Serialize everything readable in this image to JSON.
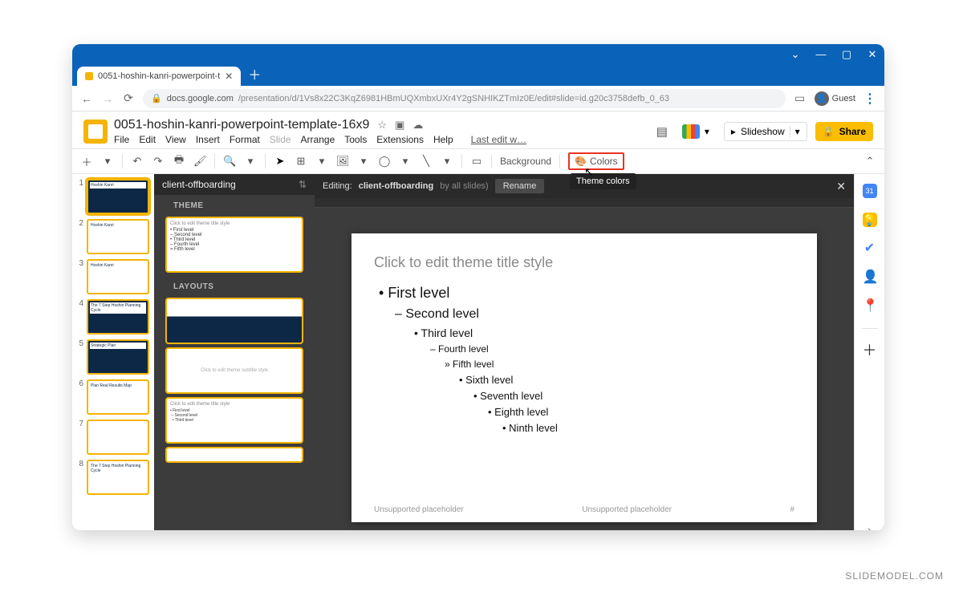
{
  "browser": {
    "tab_title": "0051-hoshin-kanri-powerpoint-t",
    "url_host": "docs.google.com",
    "url_path": "/presentation/d/1Vs8x22C3KqZ6981HBmUQXmbxUXr4Y2gSNHIKZTmIz0E/edit#slide=id.g20c3758defb_0_63",
    "guest_label": "Guest"
  },
  "header": {
    "doc_title": "0051-hoshin-kanri-powerpoint-template-16x9",
    "menus": [
      "File",
      "Edit",
      "View",
      "Insert",
      "Format",
      "Slide",
      "Arrange",
      "Tools",
      "Extensions",
      "Help"
    ],
    "last_edit": "Last edit w…",
    "slideshow": "Slideshow",
    "share": "Share"
  },
  "toolbar": {
    "background": "Background",
    "colors": "Colors",
    "tooltip": "Theme colors"
  },
  "theme_panel": {
    "name": "client-offboarding",
    "section_theme": "THEME",
    "section_layouts": "LAYOUTS",
    "theme_preview_title": "Click to edit theme title style",
    "theme_preview_lines": [
      "• First level",
      "  – Second level",
      "    • Third level",
      "      – Fourth level",
      "        » Fifth level"
    ]
  },
  "canvas": {
    "editing_label": "Editing:",
    "editing_name": "client-offboarding",
    "by_all": "by all slides)",
    "rename": "Rename",
    "slide_title": "Click to edit theme title style",
    "levels": [
      "First level",
      "Second level",
      "Third level",
      "Fourth level",
      "Fifth level",
      "Sixth level",
      "Seventh level",
      "Eighth level",
      "Ninth level"
    ],
    "unsupported": "Unsupported placeholder",
    "page_num": "#"
  },
  "thumbs": {
    "count": 8,
    "labels": [
      "Hoshin Kanri",
      "Hoshin Kanri",
      "Hoshin Kanri",
      "The 7 Step Hoshin Planning Cycle",
      "Strategic Plan",
      "Plan   Real Results   Map",
      "",
      "The 7 Step Hoshin Planning Cycle"
    ]
  },
  "watermark": "SLIDEMODEL.COM"
}
